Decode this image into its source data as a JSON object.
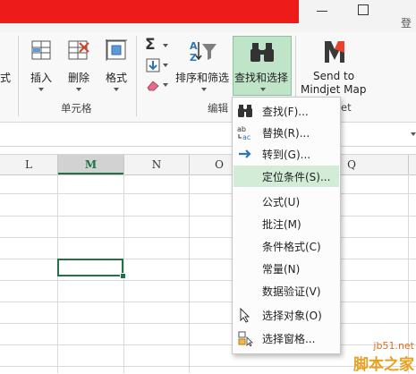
{
  "title_bar": {
    "signin_text": "登"
  },
  "ribbon": {
    "left_cut_label": "式",
    "cells_group": {
      "label": "单元格",
      "insert_label": "插入",
      "delete_label": "删除",
      "format_label": "格式"
    },
    "editing_group": {
      "label": "编辑",
      "sort_filter_label": "排序和筛选",
      "find_select_label": "查找和选择"
    },
    "addin": {
      "line1": "Send to",
      "line2": "Mindjet Map",
      "group_label_cut": "et"
    },
    "accent_color": "#217346",
    "active_button_bg": "#bfe4c8"
  },
  "columns": {
    "headers": [
      "L",
      "M",
      "N",
      "O",
      "Q"
    ],
    "selected": "M"
  },
  "menu": {
    "items": [
      {
        "label": "查找(F)...",
        "icon": "binoculars-icon"
      },
      {
        "label": "替换(R)...",
        "icon": "replace-icon"
      },
      {
        "label": "转到(G)...",
        "icon": "arrow-right-icon"
      },
      {
        "label": "定位条件(S)...",
        "icon": "none",
        "highlighted": true
      },
      {
        "label": "公式(U)",
        "icon": "none"
      },
      {
        "label": "批注(M)",
        "icon": "none"
      },
      {
        "label": "条件格式(C)",
        "icon": "none"
      },
      {
        "label": "常量(N)",
        "icon": "none"
      },
      {
        "label": "数据验证(V)",
        "icon": "none"
      },
      {
        "label": "选择对象(O)",
        "icon": "cursor-icon"
      },
      {
        "label": "选择窗格...",
        "icon": "selection-pane-icon"
      }
    ]
  },
  "watermark": {
    "url": "jb51.net",
    "text": "脚本之家"
  }
}
